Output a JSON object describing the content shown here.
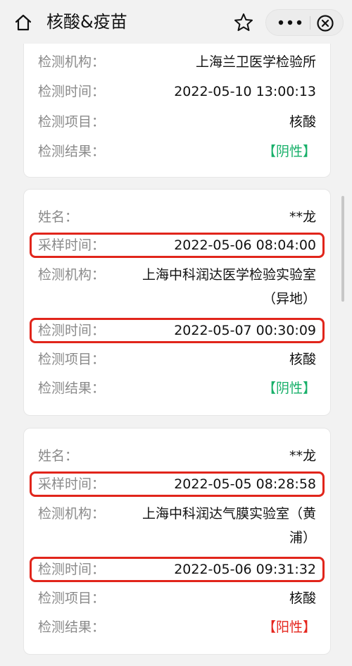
{
  "header": {
    "title": "核酸&疫苗",
    "home_icon": "home-icon",
    "star_icon": "star-icon",
    "more_icon": "more-icon",
    "close_icon": "close-icon"
  },
  "records": [
    {
      "rows": [
        {
          "label": "检测机构：",
          "value": "上海兰卫医学检验所"
        },
        {
          "label": "检测时间：",
          "value": "2022-05-10 13:00:13"
        },
        {
          "label": "检测项目：",
          "value": "核酸"
        },
        {
          "label": "检测结果：",
          "value": "【阴性】"
        }
      ]
    },
    {
      "rows": [
        {
          "label": "姓名：",
          "value": "**龙"
        },
        {
          "label": "采样时间：",
          "value": "2022-05-06 08:04:00"
        },
        {
          "label": "检测机构：",
          "value": "上海中科润达医学检验实验室（异地）"
        },
        {
          "label": "检测时间：",
          "value": "2022-05-07 00:30:09"
        },
        {
          "label": "检测项目：",
          "value": "核酸"
        },
        {
          "label": "检测结果：",
          "value": "【阴性】"
        }
      ]
    },
    {
      "rows": [
        {
          "label": "姓名：",
          "value": "**龙"
        },
        {
          "label": "采样时间：",
          "value": "2022-05-05 08:28:58"
        },
        {
          "label": "检测机构：",
          "value": "上海中科润达气膜实验室（黄浦）"
        },
        {
          "label": "检测时间：",
          "value": "2022-05-06 09:31:32"
        },
        {
          "label": "检测项目：",
          "value": "核酸"
        },
        {
          "label": "检测结果：",
          "value": "【阳性】"
        }
      ]
    }
  ],
  "colors": {
    "negative": "#18b06a",
    "positive": "#e5261e",
    "highlight_box": "#e1251b"
  }
}
